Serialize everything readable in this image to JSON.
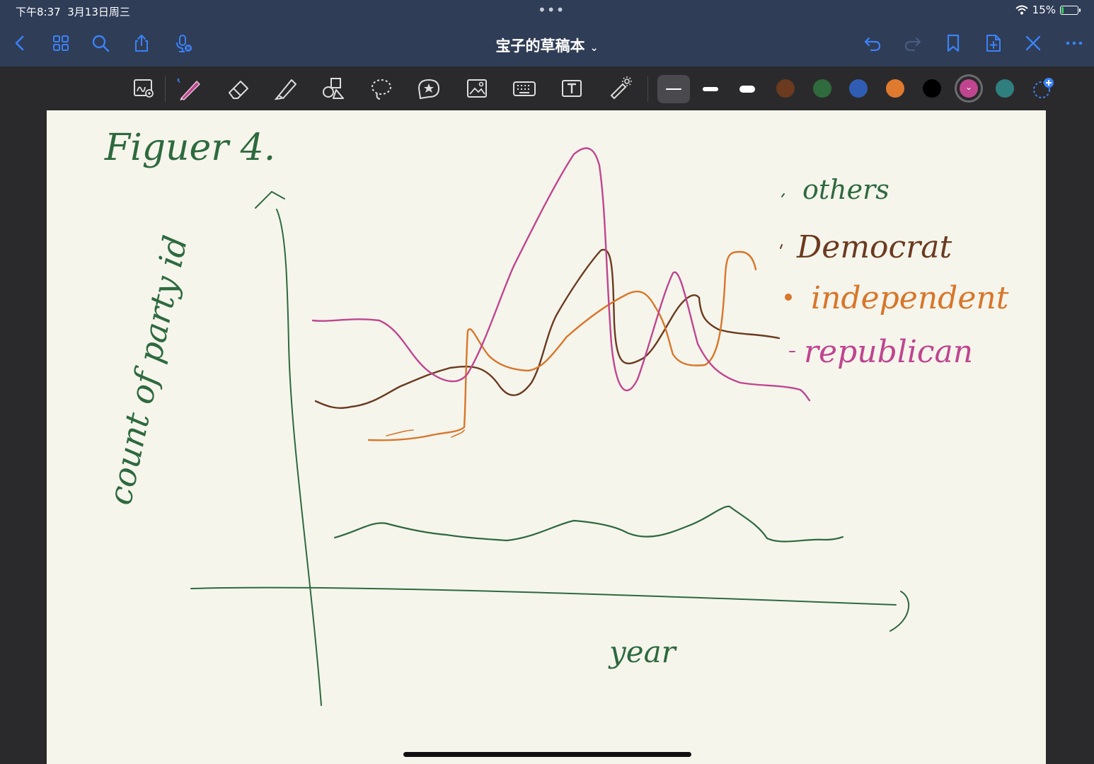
{
  "status_bar": {
    "time": "下午8:37",
    "date": "3月13日周三",
    "battery": "15%",
    "battery_level": 0.15
  },
  "nav": {
    "title": "宝子的草稿本",
    "icons": [
      "back-icon",
      "grid-icon",
      "search-icon",
      "share-icon",
      "microphone-icon",
      "undo-icon",
      "redo-icon",
      "bookmark-icon",
      "add-page-icon",
      "close-icon",
      "more-icon"
    ]
  },
  "toolbar": {
    "tools": [
      "zoom-window",
      "pen",
      "eraser",
      "highlighter",
      "shapes",
      "lasso",
      "sticker",
      "image",
      "keyboard",
      "text-box",
      "laser-pointer"
    ],
    "selected_tool": "pen",
    "stroke_widths": [
      "thin",
      "medium",
      "thick"
    ],
    "selected_width": "thin",
    "colors": [
      "#6b3a1f",
      "#2f6b3c",
      "#2f5db3",
      "#e07a2e",
      "#000000",
      "#c0458f",
      "#2f7f7f"
    ],
    "selected_color": "#c0458f"
  },
  "canvas": {
    "title": "Figuer 4.",
    "y_axis_label": "count of party id",
    "x_axis_label": "year",
    "legend": [
      {
        "label": "others",
        "color": "#2d6a3e"
      },
      {
        "label": "Democrat",
        "color": "#6b3a1f"
      },
      {
        "label": "independent",
        "color": "#d8762a"
      },
      {
        "label": "republican",
        "color": "#c0458f"
      }
    ],
    "ink_colors": {
      "others": "#2d6a3e",
      "democrat": "#6b3a1f",
      "independent": "#d8762a",
      "republican": "#c0458f",
      "axes": "#2d6a3e"
    }
  }
}
